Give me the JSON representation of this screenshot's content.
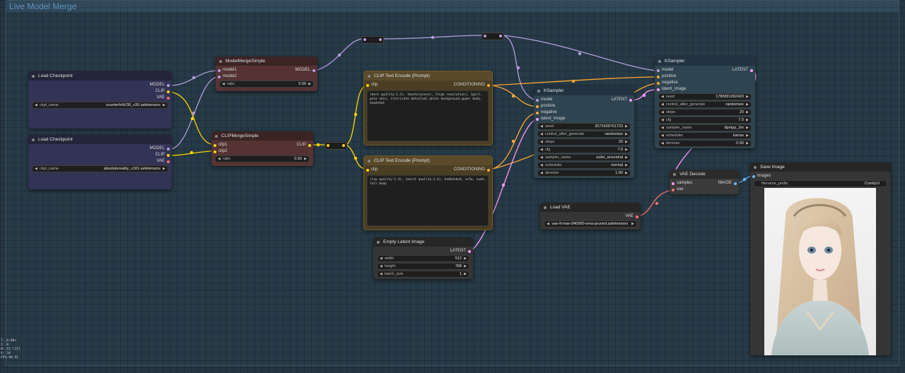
{
  "group": {
    "title": "Live Model Merge"
  },
  "colors": {
    "model": "#b39ddb",
    "clip": "#ffd500",
    "vae": "#ff6e6e",
    "conditioning": "#ffa931",
    "latent": "#ff9cf9",
    "image": "#64b5f6"
  },
  "load_checkpoint_1": {
    "title": "Load Checkpoint",
    "outputs": [
      "MODEL",
      "CLIP",
      "VAE"
    ],
    "ckpt_label": "ckpt_name",
    "ckpt_value": "counterfeitV30_v30.safetensors"
  },
  "load_checkpoint_2": {
    "title": "Load Checkpoint",
    "outputs": [
      "MODEL",
      "CLIP",
      "VAE"
    ],
    "ckpt_label": "ckpt_name",
    "ckpt_value": "absolutereality_v181.safetensors"
  },
  "model_merge": {
    "title": "ModelMergeSimple",
    "inputs": [
      "model1",
      "model2"
    ],
    "output": "MODEL",
    "ratio_label": "ratio",
    "ratio_value": "0.50"
  },
  "clip_merge": {
    "title": "CLIPMergeSimple",
    "inputs": [
      "clip1",
      "clip2"
    ],
    "output": "CLIP",
    "ratio_label": "ratio",
    "ratio_value": "0.50"
  },
  "clip_text_pos": {
    "title": "CLIP Text Encode (Prompt)",
    "input": "clip",
    "output": "CONDITIONING",
    "text": "(best quality:1.2), (masterpiece), (high resolution), 1girl, pale skin, (intricate detailed),white background,upper body, headshot"
  },
  "clip_text_neg": {
    "title": "CLIP Text Encode (Prompt)",
    "input": "clip",
    "output": "CONDITIONING",
    "text": "(low quality:1.4), (worst quality:1.4), badhandv4, nsfw, nude, full body"
  },
  "empty_latent": {
    "title": "Empty Latent Image",
    "output": "LATENT",
    "widgets": [
      {
        "label": "width",
        "value": "512"
      },
      {
        "label": "height",
        "value": "768"
      },
      {
        "label": "batch_size",
        "value": "1"
      }
    ]
  },
  "ksampler_1": {
    "title": "KSampler",
    "inputs": [
      "model",
      "positive",
      "negative",
      "latent_image"
    ],
    "output": "LATENT",
    "widgets": [
      {
        "label": "seed",
        "value": "2071639761723"
      },
      {
        "label": "control_after_generate",
        "value": "randomize"
      },
      {
        "label": "steps",
        "value": "20"
      },
      {
        "label": "cfg",
        "value": "7.0"
      },
      {
        "label": "sampler_name",
        "value": "euler_ancestral"
      },
      {
        "label": "scheduler",
        "value": "normal"
      },
      {
        "label": "denoise",
        "value": "1.00"
      }
    ]
  },
  "ksampler_2": {
    "title": "KSampler",
    "inputs": [
      "model",
      "positive",
      "negative",
      "latent_image"
    ],
    "output": "LATENT",
    "widgets": [
      {
        "label": "seed",
        "value": "1780891062420"
      },
      {
        "label": "control_after_generate",
        "value": "randomize"
      },
      {
        "label": "steps",
        "value": "20"
      },
      {
        "label": "cfg",
        "value": "7.0"
      },
      {
        "label": "sampler_name",
        "value": "dpmpp_2m"
      },
      {
        "label": "scheduler",
        "value": "karras"
      },
      {
        "label": "denoise",
        "value": "0.50"
      }
    ]
  },
  "vae_decode": {
    "title": "VAE Decode",
    "inputs": [
      "samples",
      "vae"
    ],
    "output": "IMAGE"
  },
  "load_vae": {
    "title": "Load VAE",
    "output": "VAE",
    "vae_value": "vae-ft-mse-840000-ema-pruned.safetensors"
  },
  "save_image": {
    "title": "Save Image",
    "input": "images",
    "prefix_label": "filename_prefix",
    "prefix_value": "ComfyUI"
  },
  "stats": [
    "T: 0.00s",
    "I: 0",
    "N: 15 [15]",
    "V: 34",
    "FPS:90.91"
  ]
}
